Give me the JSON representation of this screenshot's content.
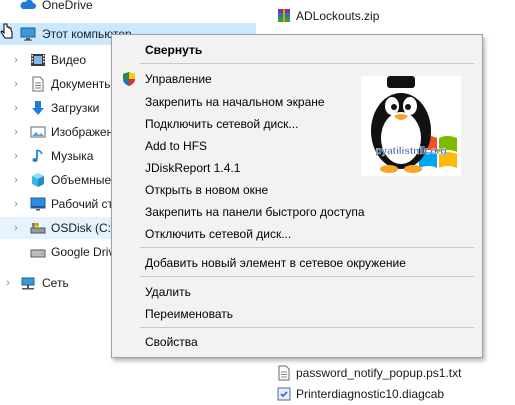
{
  "nav": {
    "items": [
      {
        "label": "OneDrive",
        "chevron": false
      },
      {
        "label": "Этот компьютер",
        "chevron": false
      },
      {
        "label": "Видео",
        "chevron": true
      },
      {
        "label": "Документы",
        "chevron": true
      },
      {
        "label": "Загрузки",
        "chevron": true
      },
      {
        "label": "Изображения",
        "chevron": true
      },
      {
        "label": "Музыка",
        "chevron": true
      },
      {
        "label": "Объемные объекты",
        "chevron": true
      },
      {
        "label": "Рабочий стол",
        "chevron": true
      },
      {
        "label": "OSDisk (C:)",
        "chevron": true
      },
      {
        "label": "Google Drive",
        "chevron": false
      },
      {
        "label": "Сеть",
        "chevron": true
      }
    ],
    "chevron_glyph": "›"
  },
  "files": {
    "items": [
      {
        "name": "ADLockouts.zip"
      },
      {
        "name": "password_notify_popup.ps1.txt"
      },
      {
        "name": "Printerdiagnostic10.diagcab"
      }
    ]
  },
  "menu": {
    "items": [
      {
        "label": "Свернуть",
        "bold": true
      },
      {
        "label": "Управление",
        "shield": true
      },
      {
        "label": "Закрепить на начальном экране"
      },
      {
        "label": "Подключить сетевой диск..."
      },
      {
        "label": "Add to HFS"
      },
      {
        "label": "JDiskReport 1.4.1"
      },
      {
        "label": "Открыть в новом окне"
      },
      {
        "label": "Закрепить на панели быстрого доступа"
      },
      {
        "label": "Отключить сетевой диск..."
      },
      {
        "label": "Добавить новый элемент в сетевое окружение"
      },
      {
        "label": "Удалить"
      },
      {
        "label": "Переименовать"
      },
      {
        "label": "Свойства"
      }
    ]
  },
  "watermark": {
    "text": "pyatilistnik.org"
  },
  "colors": {
    "selection": "#cce8ff",
    "hover": "#e5f3ff",
    "menu_bg": "#f2f2f2",
    "folder_yellow": "#e8b84a"
  }
}
